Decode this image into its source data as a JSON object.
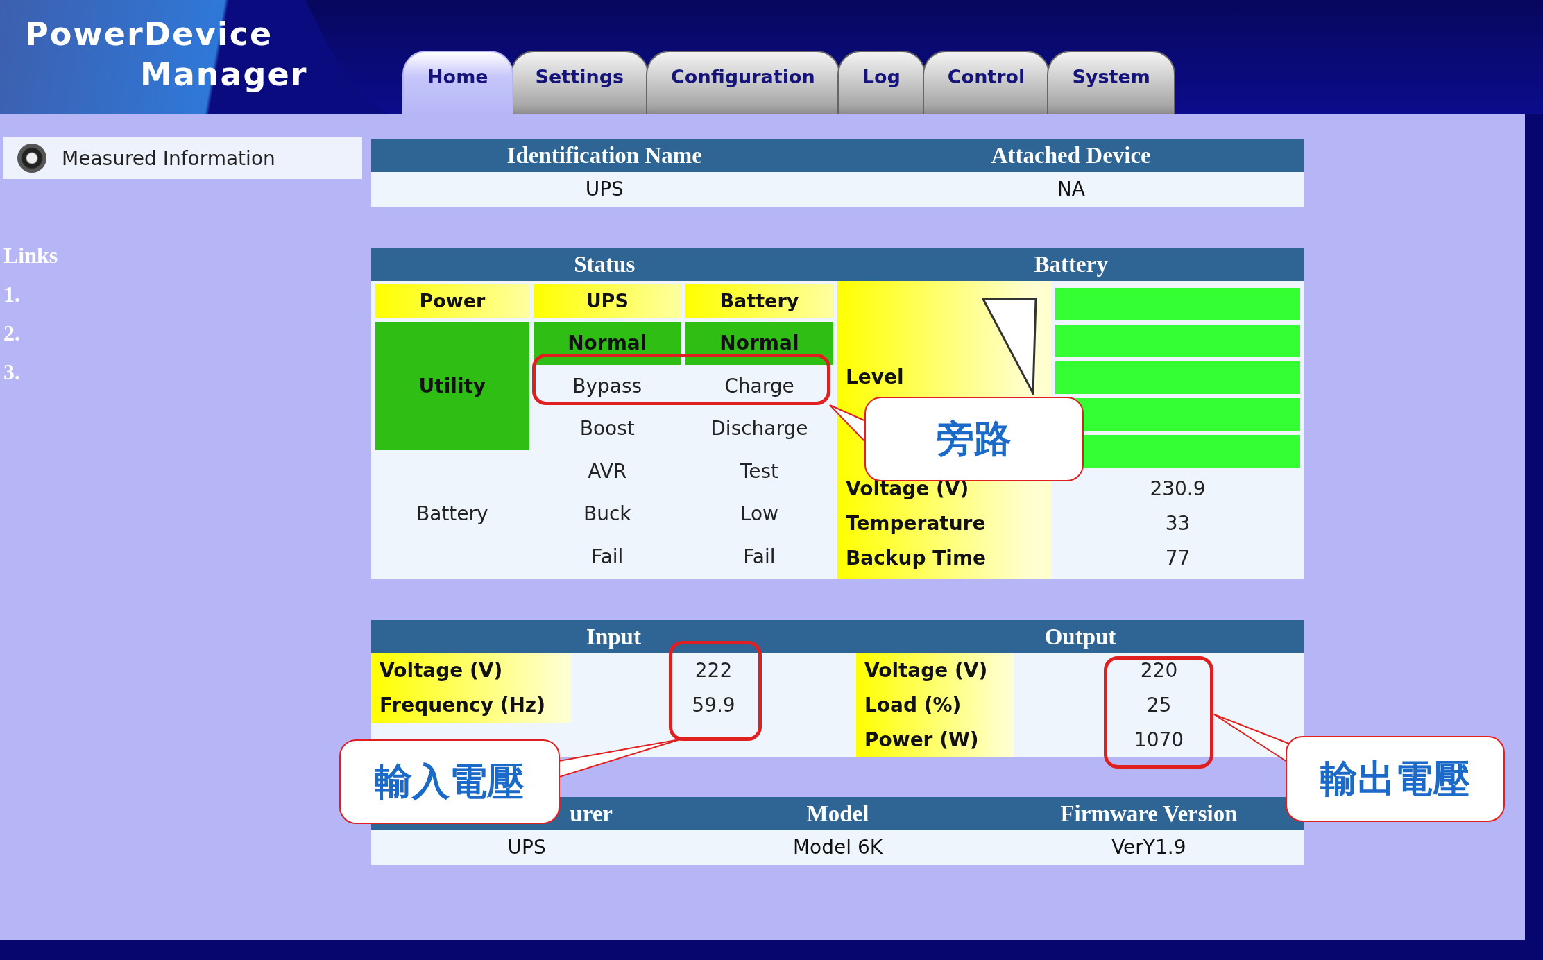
{
  "logo": {
    "line_1": "PowerDevice",
    "line_2": "Manager"
  },
  "tabs": [
    {
      "label": "Home",
      "selected": true
    },
    {
      "label": "Settings",
      "selected": false
    },
    {
      "label": "Configuration",
      "selected": false
    },
    {
      "label": "Log",
      "selected": false
    },
    {
      "label": "Control",
      "selected": false
    },
    {
      "label": "System",
      "selected": false
    }
  ],
  "sidebar": {
    "menu_item": "Measured Information",
    "links_title": "Links",
    "links": [
      "1.",
      "2.",
      "3."
    ]
  },
  "identification": {
    "columns": [
      "Identification Name",
      "Attached Device"
    ],
    "values": [
      "UPS",
      "NA"
    ]
  },
  "status": {
    "title": "Status",
    "columns": [
      {
        "label": "Power",
        "items": [
          {
            "text": "Utility",
            "active": true
          },
          {
            "text": "Battery",
            "active": false
          }
        ]
      },
      {
        "label": "UPS",
        "items": [
          {
            "text": "Normal",
            "active": true
          },
          {
            "text": "Bypass",
            "active": false
          },
          {
            "text": "Boost",
            "active": false
          },
          {
            "text": "AVR",
            "active": false
          },
          {
            "text": "Buck",
            "active": false
          },
          {
            "text": "Fail",
            "active": false
          }
        ]
      },
      {
        "label": "Battery",
        "items": [
          {
            "text": "Normal",
            "active": true
          },
          {
            "text": "Charge",
            "active": false
          },
          {
            "text": "Discharge",
            "active": false
          },
          {
            "text": "Test",
            "active": false
          },
          {
            "text": "Low",
            "active": false
          },
          {
            "text": "Fail",
            "active": false
          }
        ]
      }
    ]
  },
  "battery": {
    "title": "Battery",
    "level_label": "Level",
    "level": 1,
    "readings": [
      {
        "label": "Voltage (V)",
        "value": "230.9"
      },
      {
        "label": "Temperature",
        "value": "33"
      },
      {
        "label": "Backup Time",
        "value": "77"
      }
    ]
  },
  "input": {
    "title": "Input",
    "readings": [
      {
        "label": "Voltage (V)",
        "value": "222"
      },
      {
        "label": "Frequency (Hz)",
        "value": "59.9"
      }
    ]
  },
  "output": {
    "title": "Output",
    "readings": [
      {
        "label": "Voltage (V)",
        "value": "220"
      },
      {
        "label": "Load (%)",
        "value": "25"
      },
      {
        "label": "Power (W)",
        "value": "1070"
      }
    ]
  },
  "device_info": {
    "columns": [
      "urer",
      "Model",
      "Firmware Version"
    ],
    "values": [
      "UPS",
      "Model 6K",
      "VerY1.9"
    ]
  },
  "annotations": [
    {
      "text": "旁路"
    },
    {
      "text": "輸入電壓"
    },
    {
      "text": "輸出電壓"
    }
  ]
}
